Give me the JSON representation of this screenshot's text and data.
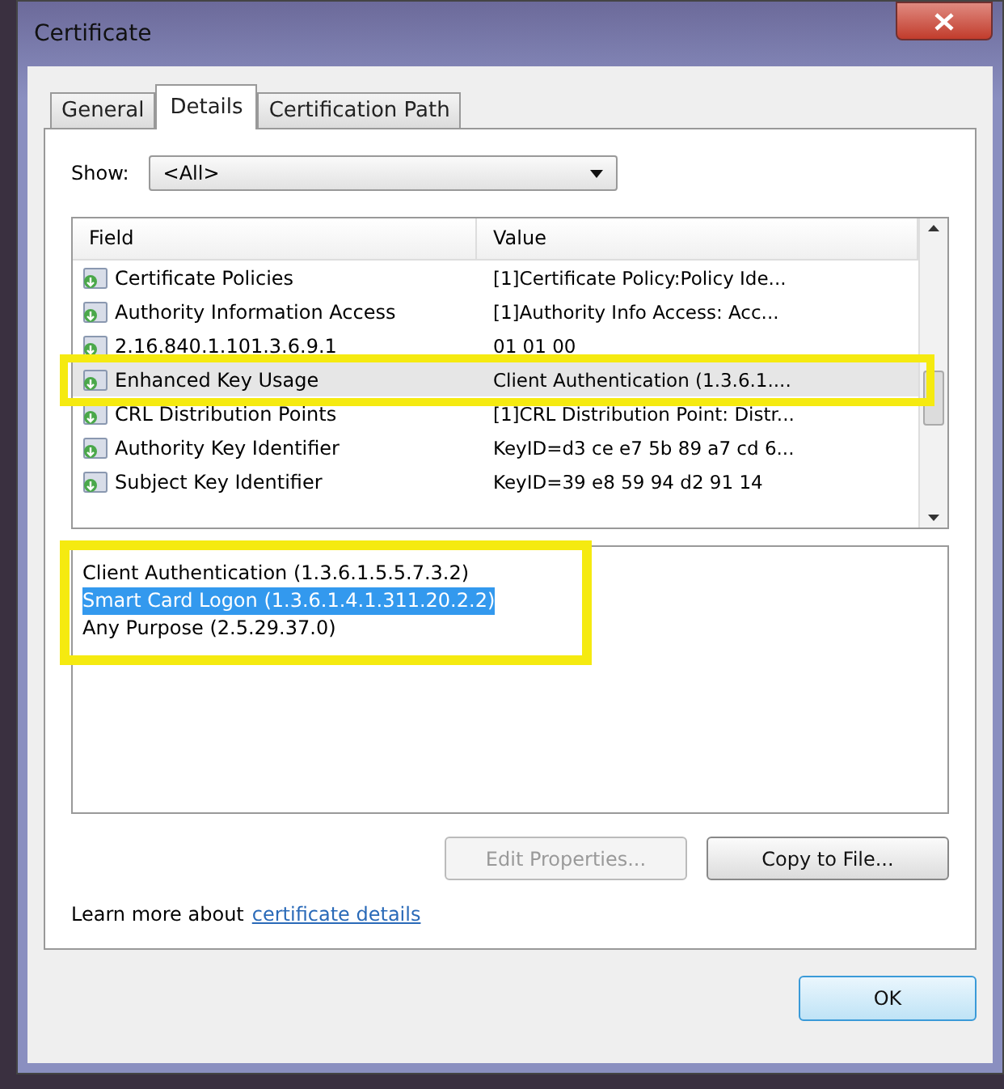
{
  "window": {
    "title": "Certificate"
  },
  "tabs": [
    {
      "label": "General",
      "selected": false
    },
    {
      "label": "Details",
      "selected": true
    },
    {
      "label": "Certification Path",
      "selected": false
    }
  ],
  "show": {
    "label": "Show:",
    "value": "<All>"
  },
  "fields": {
    "columns": [
      "Field",
      "Value"
    ],
    "rows": [
      {
        "field": "Certificate Policies",
        "value": "[1]Certificate Policy:Policy Ide...",
        "selected": false
      },
      {
        "field": "Authority Information Access",
        "value": "[1]Authority Info Access: Acc...",
        "selected": false
      },
      {
        "field": "2.16.840.1.101.3.6.9.1",
        "value": "01 01 00",
        "selected": false
      },
      {
        "field": "Enhanced Key Usage",
        "value": "Client Authentication (1.3.6.1....",
        "selected": true
      },
      {
        "field": "CRL Distribution Points",
        "value": "[1]CRL Distribution Point: Distr...",
        "selected": false
      },
      {
        "field": "Authority Key Identifier",
        "value": "KeyID=d3 ce e7 5b 89 a7 cd 6...",
        "selected": false
      },
      {
        "field": "Subject Key Identifier",
        "value": "KeyID=39 e8 59 94 d2 91 14",
        "selected": false
      }
    ]
  },
  "details": [
    {
      "text": "Client Authentication (1.3.6.1.5.5.7.3.2)",
      "selected": false
    },
    {
      "text": "Smart Card Logon (1.3.6.1.4.1.311.20.2.2)",
      "selected": true
    },
    {
      "text": "Any Purpose (2.5.29.37.0)",
      "selected": false
    }
  ],
  "buttons": [
    {
      "label": "Edit Properties...",
      "disabled": true
    },
    {
      "label": "Copy to File...",
      "disabled": false
    }
  ],
  "learn_more": {
    "text": "Learn more about",
    "link": "certificate details"
  },
  "footer_buttons": [
    {
      "label": "OK"
    }
  ]
}
